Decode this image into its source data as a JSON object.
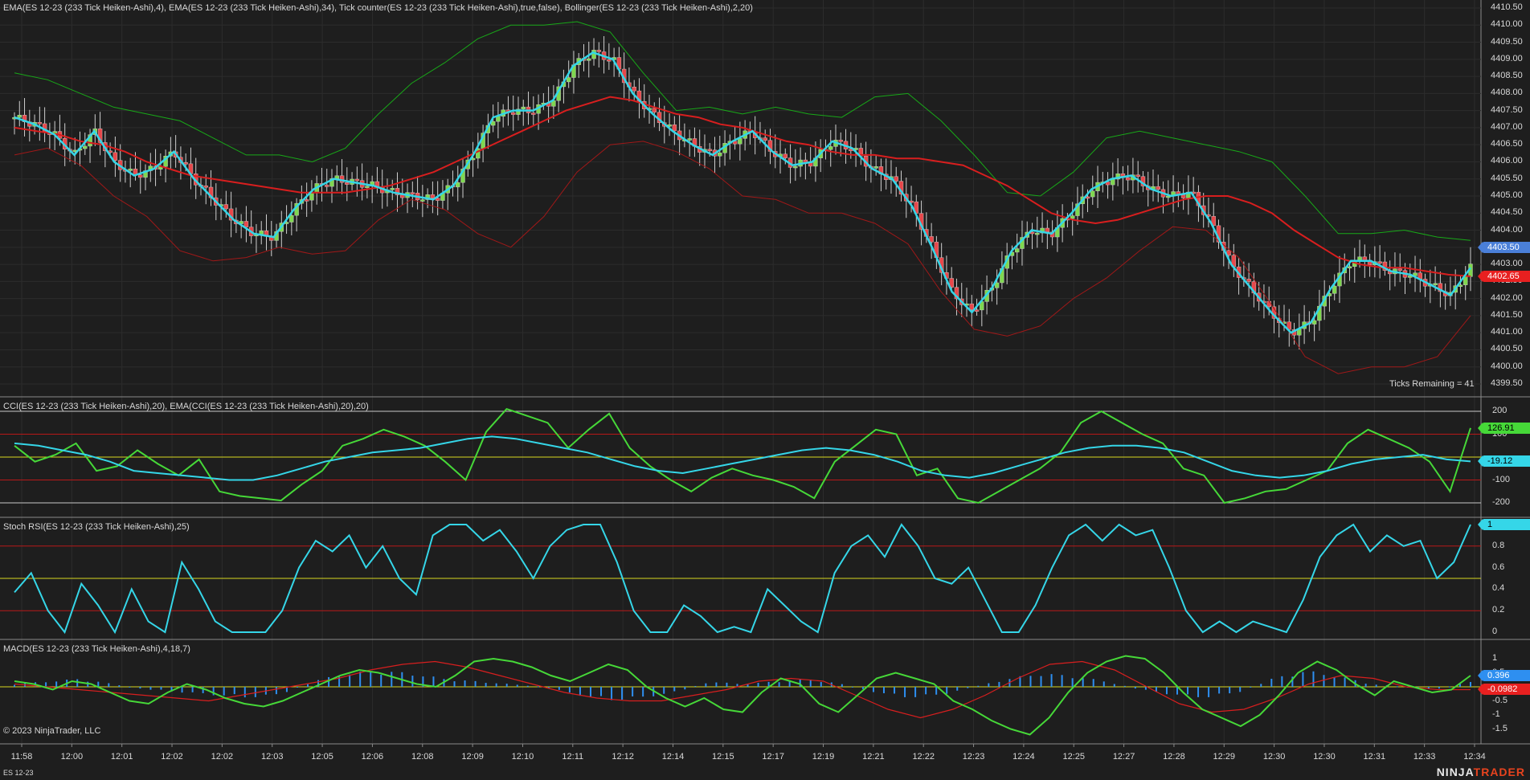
{
  "instrument": "ES 12-23",
  "copyright": "© 2023 NinjaTrader, LLC",
  "brand": {
    "part1": "NINJA",
    "part2": "TRADER"
  },
  "colors": {
    "background": "#1e1e1e",
    "up_candle": "#7fd84f",
    "down_candle": "#e8474a",
    "ema_fast": "#35d6e8",
    "ema_slow": "#d81e1e",
    "bollinger_upper": "#18a818",
    "bollinger_lower": "#a01818",
    "cci": "#46d838",
    "cci_ema": "#35d6e8",
    "stoch": "#35d6e8",
    "macd": "#46d838",
    "macd_avg": "#d81e1e",
    "macd_hist": "#2e8ff0",
    "level_red": "#b81818",
    "level_yellow": "#d8d820",
    "level_white": "#c8c8c8"
  },
  "price_panel": {
    "title": "EMA(ES 12-23 (233 Tick Heiken-Ashi),4), EMA(ES 12-23 (233 Tick Heiken-Ashi),34), Tick counter(ES 12-23 (233 Tick Heiken-Ashi),true,false), Bollinger(ES 12-23 (233 Tick Heiken-Ashi),2,20)",
    "ticks_remaining": "Ticks Remaining = 41",
    "y_ticks": [
      "4410.50",
      "4410.00",
      "4409.50",
      "4409.00",
      "4408.50",
      "4408.00",
      "4407.50",
      "4407.00",
      "4406.50",
      "4406.00",
      "4405.50",
      "4405.00",
      "4404.50",
      "4404.00",
      "4403.50",
      "4403.00",
      "4402.50",
      "4402.00",
      "4401.50",
      "4401.00",
      "4400.50",
      "4400.00",
      "4399.50"
    ],
    "badges": [
      {
        "label": "4403.50",
        "color": "#4a7fd8",
        "text": "#ffffff"
      },
      {
        "label": "4402.65",
        "color": "#e82020",
        "text": "#ffffff"
      }
    ]
  },
  "cci_panel": {
    "title": "CCI(ES 12-23 (233 Tick Heiken-Ashi),20), EMA(CCI(ES 12-23 (233 Tick Heiken-Ashi),20),20)",
    "y_ticks": [
      "200",
      "100",
      "-100",
      "-200"
    ],
    "badges": [
      {
        "label": "126.91",
        "color": "#46d838",
        "text": "#000000"
      },
      {
        "label": "-19.12",
        "color": "#35d6e8",
        "text": "#000000"
      }
    ]
  },
  "stoch_panel": {
    "title": "Stoch RSI(ES 12-23 (233 Tick Heiken-Ashi),25)",
    "y_ticks": [
      "0.8",
      "0.6",
      "0.4",
      "0.2",
      "0"
    ],
    "badges": [
      {
        "label": "1",
        "color": "#35d6e8",
        "text": "#000000"
      }
    ]
  },
  "macd_panel": {
    "title": "MACD(ES 12-23 (233 Tick Heiken-Ashi),4,18,7)",
    "y_ticks": [
      "1",
      "0.5",
      "-0.5",
      "-1",
      "-1.5"
    ],
    "badges": [
      {
        "label": "0.396",
        "color": "#2e8ff0",
        "text": "#ffffff"
      },
      {
        "label": "-0.0982",
        "color": "#e82020",
        "text": "#ffffff"
      }
    ]
  },
  "time_axis": [
    "11:58",
    "12:00",
    "12:01",
    "12:02",
    "12:02",
    "12:03",
    "12:05",
    "12:06",
    "12:08",
    "12:09",
    "12:10",
    "12:11",
    "12:12",
    "12:14",
    "12:15",
    "12:17",
    "12:19",
    "12:21",
    "12:22",
    "12:23",
    "12:24",
    "12:25",
    "12:27",
    "12:28",
    "12:29",
    "12:30",
    "12:30",
    "12:31",
    "12:33",
    "12:34"
  ],
  "chart_data": [
    {
      "type": "candlestick",
      "title": "EMA(ES 12-23 (233 Tick Heiken-Ashi),4), EMA(ES 12-23 (233 Tick Heiken-Ashi),34), Tick counter(ES 12-23 (233 Tick Heiken-Ashi),true,false), Bollinger(ES 12-23 (233 Tick Heiken-Ashi),2,20)",
      "ylim": [
        4399.5,
        4410.5
      ],
      "close_path": [
        4407.3,
        4407.1,
        4406.8,
        4406.2,
        4406.9,
        4406.0,
        4405.6,
        4405.8,
        4406.3,
        4405.5,
        4404.9,
        4404.3,
        4403.9,
        4403.8,
        4404.6,
        4405.2,
        4405.5,
        4405.4,
        4405.3,
        4405.1,
        4405.0,
        4404.9,
        4405.3,
        4406.2,
        4407.3,
        4407.5,
        4407.5,
        4407.8,
        4408.8,
        4409.2,
        4409.0,
        4408.0,
        4407.4,
        4406.9,
        4406.5,
        4406.2,
        4406.6,
        4406.9,
        4406.3,
        4405.9,
        4406.0,
        4406.6,
        4406.4,
        4405.8,
        4405.5,
        4404.7,
        4403.5,
        4402.2,
        4401.6,
        4402.3,
        4403.4,
        4404.0,
        4403.9,
        4404.5,
        4405.2,
        4405.5,
        4405.6,
        4405.2,
        4405.0,
        4405.1,
        4404.2,
        4403.0,
        4402.3,
        4401.6,
        4401.0,
        4401.3,
        4402.3,
        4403.1,
        4403.1,
        4402.8,
        4402.7,
        4402.4,
        4402.1,
        4402.9
      ],
      "ema34_path": [
        4407.0,
        4406.9,
        4406.8,
        4406.6,
        4406.5,
        4406.3,
        4406.0,
        4405.8,
        4405.6,
        4405.5,
        4405.4,
        4405.3,
        4405.2,
        4405.1,
        4405.1,
        4405.1,
        4405.2,
        4405.3,
        4405.5,
        4405.7,
        4406.0,
        4406.3,
        4406.6,
        4406.9,
        4407.2,
        4407.5,
        4407.7,
        4407.9,
        4407.8,
        4407.6,
        4407.4,
        4407.3,
        4407.1,
        4407.0,
        4406.8,
        4406.6,
        4406.5,
        4406.3,
        4406.2,
        4406.2,
        4406.1,
        4406.1,
        4406.0,
        4405.9,
        4405.6,
        4405.3,
        4404.9,
        4404.5,
        4404.3,
        4404.2,
        4404.3,
        4404.5,
        4404.7,
        4404.9,
        4405.0,
        4405.0,
        4404.8,
        4404.5,
        4404.0,
        4403.6,
        4403.2,
        4403.0,
        4402.9,
        4402.9,
        4402.8,
        4402.7,
        4402.65
      ],
      "bollinger_upper_path": [
        4408.6,
        4408.4,
        4408.0,
        4407.6,
        4407.4,
        4407.2,
        4406.7,
        4406.2,
        4406.2,
        4406.0,
        4406.4,
        4407.4,
        4408.3,
        4408.9,
        4409.6,
        4410.0,
        4410.0,
        4410.1,
        4409.8,
        4408.6,
        4407.5,
        4407.6,
        4407.4,
        4407.6,
        4407.4,
        4407.3,
        4407.9,
        4408.0,
        4407.2,
        4406.2,
        4405.1,
        4405.0,
        4405.7,
        4406.7,
        4406.9,
        4406.7,
        4406.5,
        4406.3,
        4406.0,
        4405.0,
        4403.9,
        4403.9,
        4404.0,
        4403.8,
        4403.7
      ],
      "bollinger_lower_path": [
        4406.2,
        4406.4,
        4405.9,
        4405.0,
        4404.4,
        4403.4,
        4403.1,
        4403.2,
        4403.5,
        4403.3,
        4403.4,
        4404.3,
        4404.9,
        4404.6,
        4403.9,
        4403.5,
        4404.4,
        4405.7,
        4406.5,
        4406.6,
        4406.3,
        4405.8,
        4405.0,
        4404.9,
        4404.5,
        4404.5,
        4404.2,
        4403.6,
        4402.2,
        4401.1,
        4400.9,
        4401.2,
        4402.0,
        4402.6,
        4403.4,
        4404.1,
        4404.0,
        4403.2,
        4401.8,
        4400.3,
        4399.8,
        4400.0,
        4400.0,
        4400.3,
        4401.5
      ]
    },
    {
      "type": "line",
      "title": "CCI(ES 12-23 (233 Tick Heiken-Ashi),20), EMA(CCI(ES 12-23 (233 Tick Heiken-Ashi),20),20)",
      "ylim": [
        -200,
        200
      ],
      "series": [
        {
          "values": [
            50,
            -20,
            10,
            60,
            -60,
            -40,
            30,
            -30,
            -80,
            -10,
            -150,
            -170,
            -180,
            -190,
            -120,
            -60,
            50,
            80,
            120,
            90,
            50,
            -20,
            -100,
            110,
            210,
            180,
            150,
            40,
            120,
            190,
            40,
            -40,
            -100,
            -150,
            -90,
            -50,
            -80,
            -100,
            -130,
            -180,
            -20,
            50,
            120,
            100,
            -80,
            -50,
            -180,
            -200,
            -150,
            -100,
            -50,
            20,
            150,
            200,
            150,
            100,
            60,
            -50,
            -80,
            -200,
            -180,
            -150,
            -140,
            -100,
            -60,
            60,
            120,
            80,
            40,
            -20,
            -150,
            127
          ]
        },
        {
          "values": [
            60,
            50,
            30,
            10,
            -20,
            -60,
            -70,
            -80,
            -90,
            -100,
            -100,
            -80,
            -50,
            -20,
            0,
            20,
            30,
            40,
            60,
            80,
            90,
            80,
            60,
            40,
            20,
            -10,
            -40,
            -60,
            -70,
            -50,
            -30,
            -10,
            10,
            30,
            40,
            30,
            10,
            -20,
            -60,
            -80,
            -90,
            -70,
            -40,
            -10,
            20,
            40,
            50,
            50,
            40,
            20,
            -20,
            -60,
            -80,
            -90,
            -80,
            -60,
            -30,
            -10,
            0,
            10,
            -10,
            -19
          ]
        }
      ]
    },
    {
      "type": "line",
      "title": "Stoch RSI(ES 12-23 (233 Tick Heiken-Ashi),25)",
      "ylim": [
        0,
        1
      ],
      "series": [
        {
          "values": [
            0.37,
            0.55,
            0.2,
            0,
            0.45,
            0.25,
            0,
            0.4,
            0.1,
            0,
            0.65,
            0.4,
            0.1,
            0,
            0,
            0,
            0.2,
            0.6,
            0.85,
            0.75,
            0.9,
            0.6,
            0.8,
            0.5,
            0.35,
            0.9,
            1,
            1,
            0.85,
            0.95,
            0.75,
            0.5,
            0.8,
            0.95,
            1,
            1,
            0.65,
            0.2,
            0,
            0,
            0.25,
            0.15,
            0,
            0.05,
            0,
            0.4,
            0.25,
            0.1,
            0,
            0.55,
            0.8,
            0.9,
            0.7,
            1,
            0.8,
            0.5,
            0.45,
            0.6,
            0.3,
            0,
            0,
            0.25,
            0.6,
            0.9,
            1,
            0.85,
            1,
            0.9,
            0.95,
            0.6,
            0.2,
            0,
            0.1,
            0,
            0.1,
            0.05,
            0,
            0.3,
            0.7,
            0.9,
            1,
            0.75,
            0.9,
            0.8,
            0.85,
            0.5,
            0.65,
            1
          ]
        }
      ]
    },
    {
      "type": "bar",
      "title": "MACD(ES 12-23 (233 Tick Heiken-Ashi),4,18,7)",
      "ylim": [
        -1.8,
        1.4
      ],
      "series": [
        {
          "values": [
            0.2,
            0.1,
            -0.1,
            0.2,
            0.1,
            -0.2,
            -0.5,
            -0.6,
            -0.2,
            0.1,
            -0.1,
            -0.4,
            -0.6,
            -0.7,
            -0.5,
            -0.2,
            0.1,
            0.4,
            0.6,
            0.5,
            0.3,
            0.1,
            0,
            0.4,
            0.9,
            1.0,
            0.9,
            0.7,
            0.4,
            0.2,
            0.5,
            0.8,
            0.6,
            0.0,
            -0.4,
            -0.7,
            -0.4,
            -0.8,
            -0.9,
            -0.2,
            0.3,
            0.1,
            -0.6,
            -0.9,
            -0.3,
            0.3,
            0.5,
            0.3,
            0.1,
            -0.5,
            -0.8,
            -1.2,
            -1.5,
            -1.7,
            -1.1,
            -0.2,
            0.5,
            0.9,
            1.1,
            1.0,
            0.5,
            -0.2,
            -0.8,
            -1.1,
            -1.4,
            -1.0,
            -0.3,
            0.5,
            0.9,
            0.6,
            0.1,
            -0.3,
            0.2,
            0.0,
            -0.2,
            -0.1,
            0.4
          ]
        },
        {
          "values": [
            0.1,
            0.0,
            -0.1,
            -0.2,
            -0.3,
            -0.4,
            -0.5,
            -0.3,
            -0.1,
            0.1,
            0.3,
            0.6,
            0.8,
            0.9,
            0.7,
            0.4,
            0.1,
            -0.2,
            -0.4,
            -0.5,
            -0.5,
            -0.3,
            -0.1,
            0.2,
            0.3,
            0.2,
            -0.3,
            -0.8,
            -1.1,
            -0.8,
            -0.3,
            0.3,
            0.8,
            0.9,
            0.6,
            0.0,
            -0.6,
            -0.9,
            -0.8,
            -0.4,
            0.1,
            0.4,
            0.3,
            0.0,
            -0.1,
            -0.1
          ]
        },
        {
          "values": [
            0.1,
            0.2,
            0.3,
            0.1,
            -0.1,
            -0.2,
            -0.3,
            -0.4,
            -0.3,
            0.2,
            0.5,
            0.6,
            0.5,
            0.3,
            0.2,
            0.1,
            0.0,
            -0.3,
            -0.5,
            -0.4,
            -0.2,
            0.2,
            0.1,
            0.2,
            0.3,
            0.1,
            -0.2,
            -0.4,
            -0.3,
            0.0,
            0.3,
            0.5,
            0.4,
            0.2,
            -0.1,
            -0.3,
            -0.4,
            -0.2,
            0.3,
            0.6,
            0.4,
            0.1,
            0.0,
            -0.1,
            0.2
          ]
        }
      ]
    }
  ]
}
